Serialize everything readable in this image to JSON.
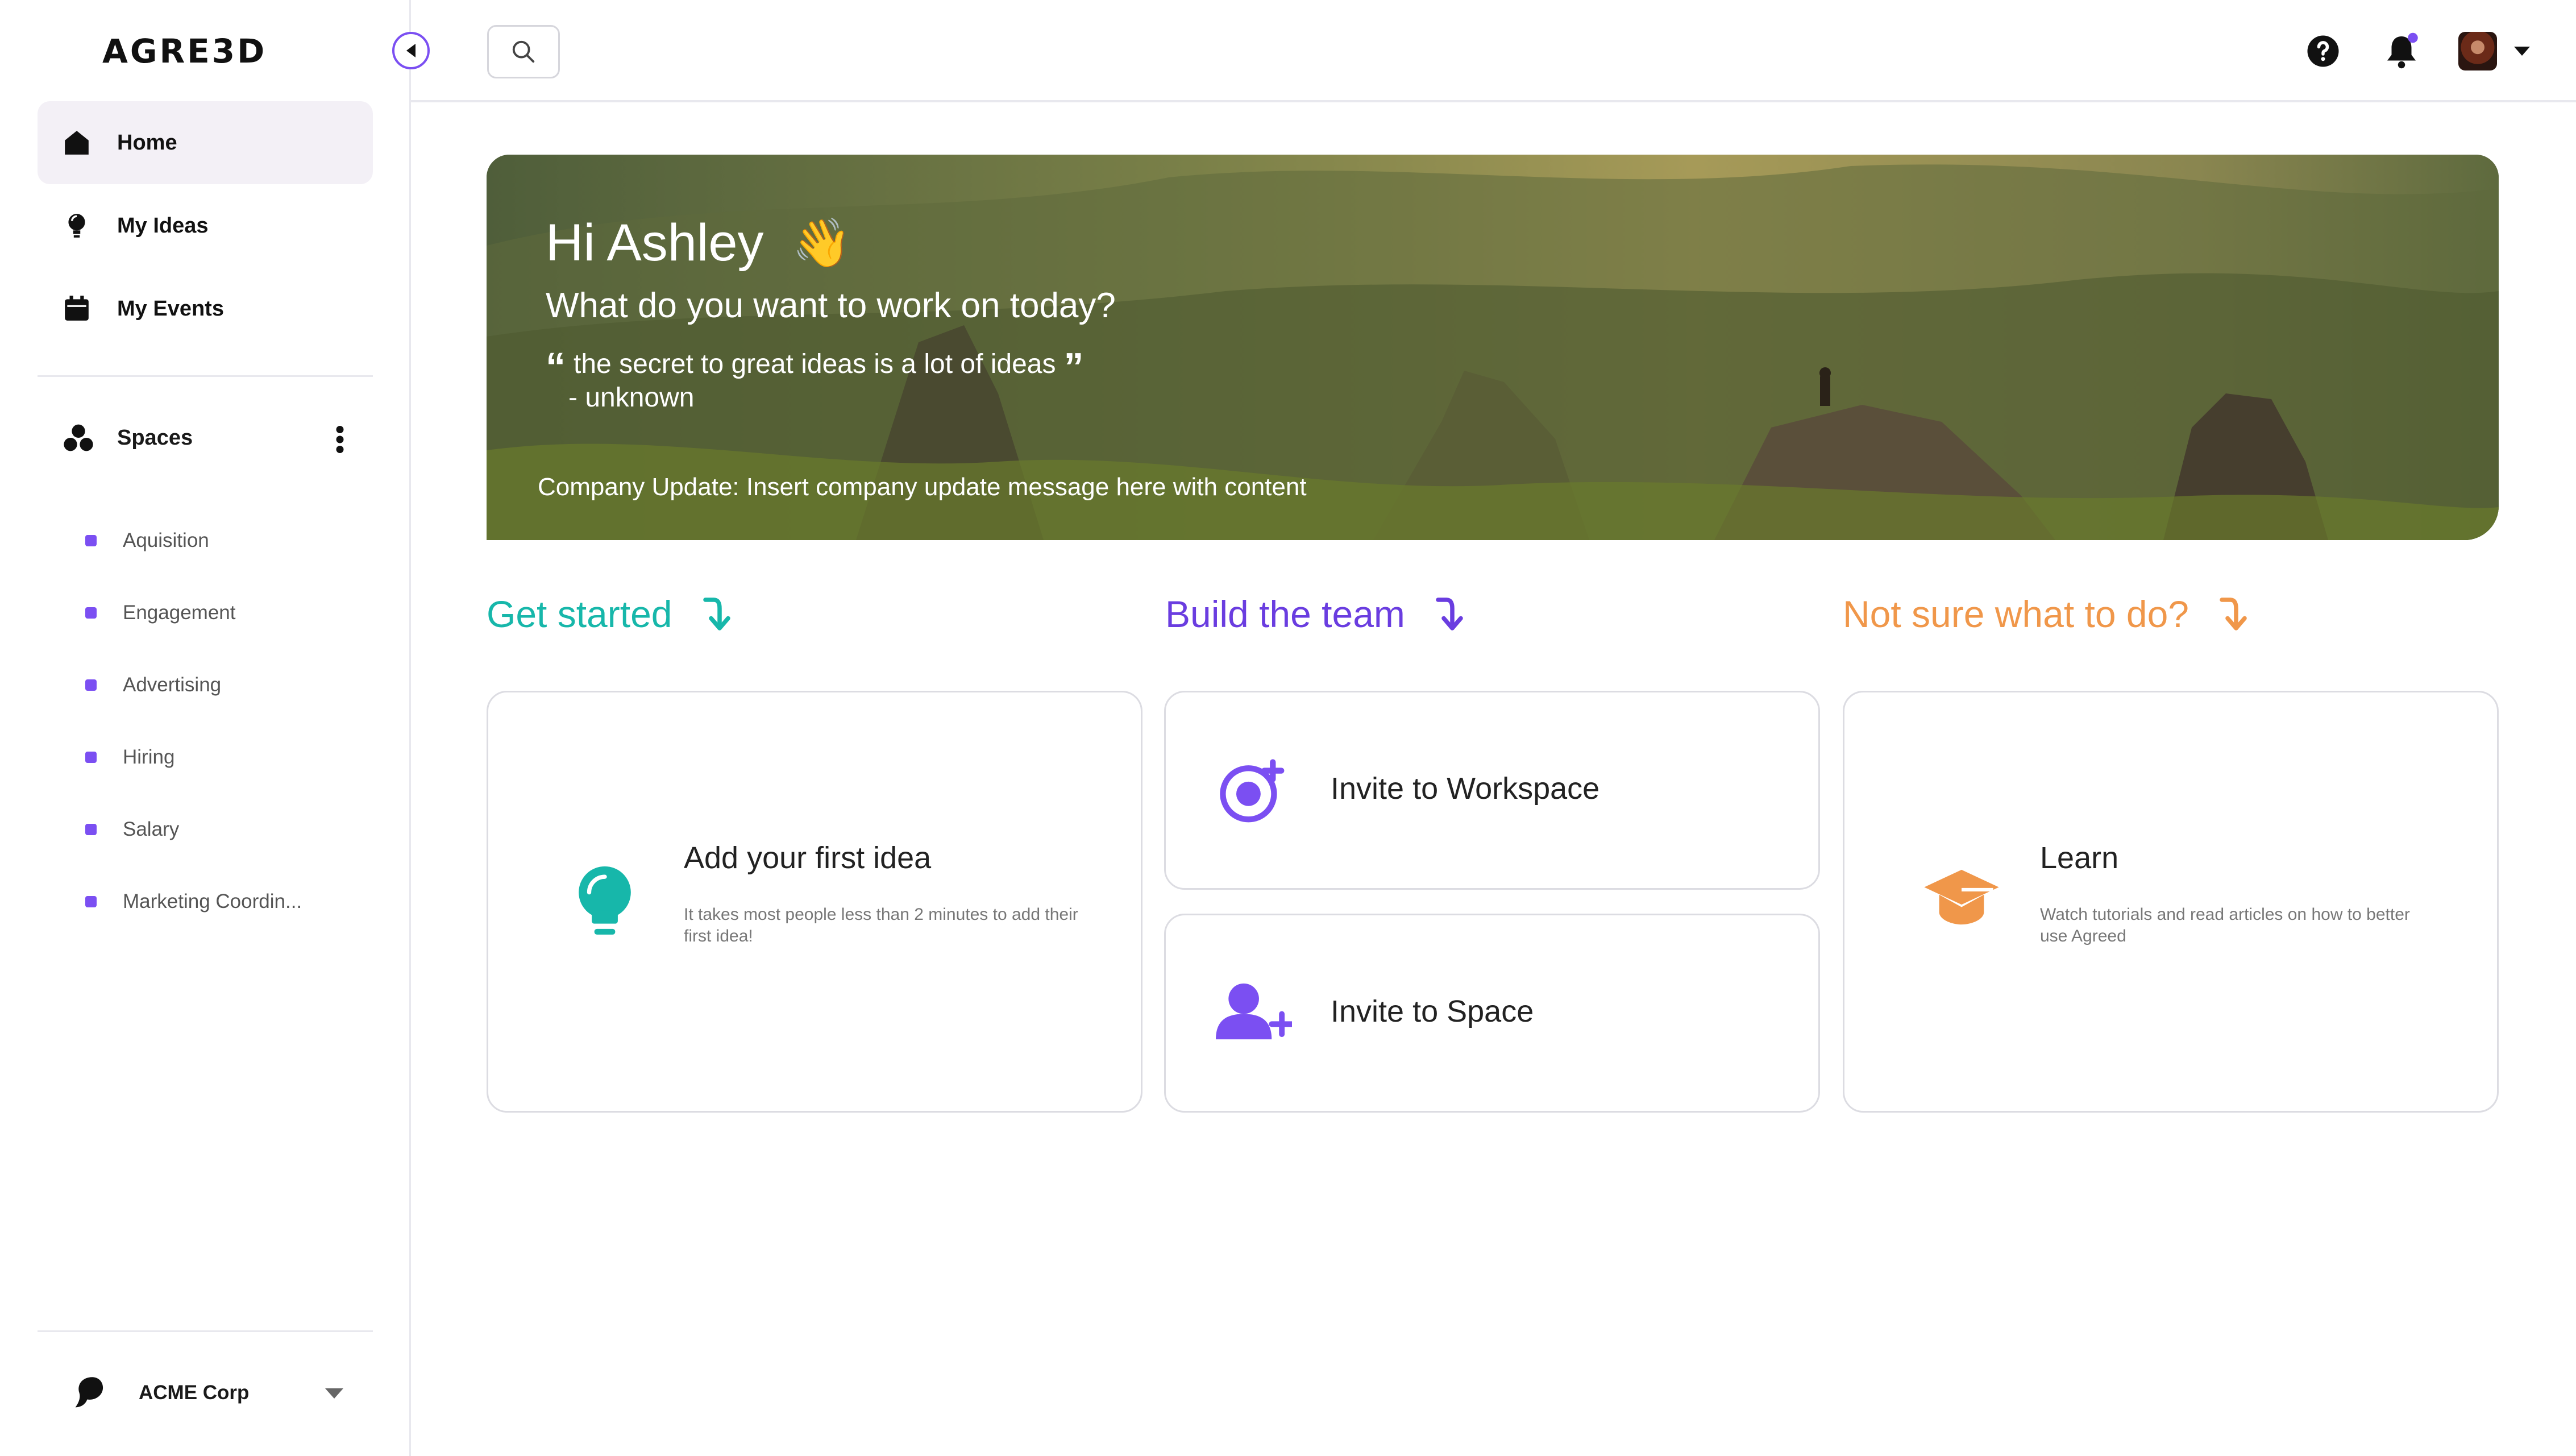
{
  "app": {
    "logo_text": "AGRE3D",
    "brand_color": "#7b4ff2"
  },
  "sidebar": {
    "nav": [
      {
        "label": "Home",
        "icon": "home-icon",
        "active": true
      },
      {
        "label": "My Ideas",
        "icon": "lightbulb-icon",
        "active": false
      },
      {
        "label": "My Events",
        "icon": "calendar-icon",
        "active": false
      }
    ],
    "spaces_label": "Spaces",
    "spaces": [
      {
        "label": "Aquisition"
      },
      {
        "label": "Engagement"
      },
      {
        "label": "Advertising"
      },
      {
        "label": "Hiring"
      },
      {
        "label": "Salary"
      },
      {
        "label": "Marketing Coordin..."
      }
    ],
    "org_name": "ACME Corp"
  },
  "topbar": {
    "icons": [
      "search-icon",
      "help-icon",
      "bell-icon",
      "avatar",
      "chevron-down-icon"
    ],
    "has_unread_notification": true
  },
  "hero": {
    "greeting": "Hi Ashley",
    "wave_emoji": "👋",
    "question": "What do you want to work on today?",
    "quote": "the secret to great ideas is a lot of ideas",
    "quote_open": "“",
    "quote_close": "”",
    "quote_author": "- unknown",
    "company_update": "Company Update: Insert company update message here with content"
  },
  "sections": {
    "get_started": {
      "label": "Get started",
      "color": "#17b7aa"
    },
    "build_team": {
      "label": "Build the team",
      "color": "#6a3de0"
    },
    "not_sure": {
      "label": "Not sure what to do?",
      "color": "#f0974a"
    }
  },
  "cards": {
    "first_idea": {
      "title": "Add your first idea",
      "desc": "It takes most people less than 2 minutes to add their first idea!"
    },
    "invite_workspace": {
      "title": "Invite to Workspace"
    },
    "invite_space": {
      "title": "Invite to Space"
    },
    "learn": {
      "title": "Learn",
      "desc": "Watch tutorials and read articles on how to better use Agreed"
    }
  }
}
